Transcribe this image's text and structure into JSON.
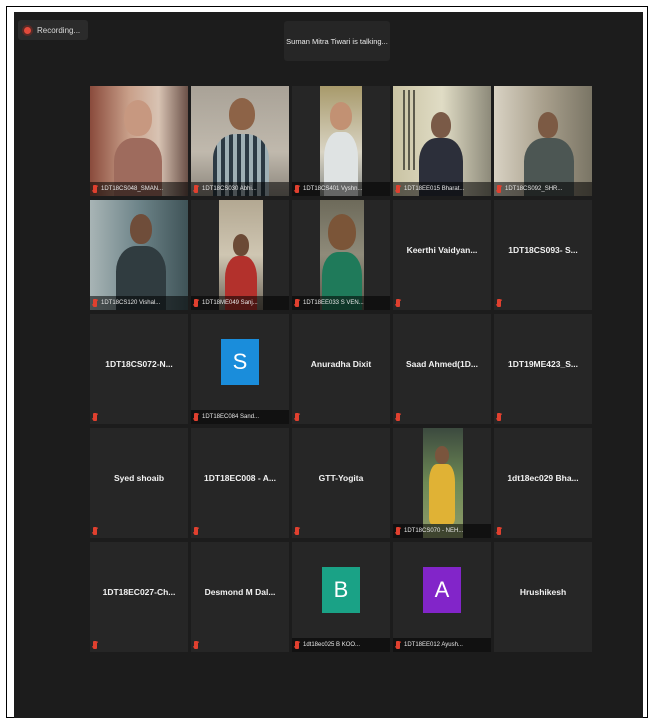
{
  "recording": {
    "label": "Recording..."
  },
  "speaking": {
    "text": "Suman Mitra Tiwari is talking..."
  },
  "colors": {
    "avatar_s": "#1a8ddb",
    "avatar_b": "#1aa286",
    "avatar_a": "#8225c9",
    "mic_muted": "#e0402f"
  },
  "participants": [
    {
      "name": "1DT18CS048_SMAN...",
      "display": "video"
    },
    {
      "name": "1DT18CS030 Abhi...",
      "display": "video"
    },
    {
      "name": "1DT18CS401 Vyshn...",
      "display": "video"
    },
    {
      "name": "1DT18EE015 Bharat...",
      "display": "video"
    },
    {
      "name": "1DT18CS092_SHR...",
      "display": "video"
    },
    {
      "name": "1DT18CS120 Vishal...",
      "display": "video"
    },
    {
      "name": "1DT18ME049 Sanj...",
      "display": "video"
    },
    {
      "name": "1DT18EE033 S VEN...",
      "display": "video"
    },
    {
      "name": "Keerthi Vaidyan...",
      "display": "name"
    },
    {
      "name": "1DT18CS093- S...",
      "display": "name"
    },
    {
      "name": "1DT18CS072-N...",
      "display": "name"
    },
    {
      "name": "1DT18EC084 Sand...",
      "display": "avatar",
      "letter": "S"
    },
    {
      "name": "Anuradha Dixit",
      "display": "name"
    },
    {
      "name": "Saad Ahmed(1D...",
      "display": "name"
    },
    {
      "name": "1DT19ME423_S...",
      "display": "name"
    },
    {
      "name": "Syed shoaib",
      "display": "name"
    },
    {
      "name": "1DT18EC008 - A...",
      "display": "name"
    },
    {
      "name": "GTT-Yogita",
      "display": "name"
    },
    {
      "name": "1DT18CS070 - NEH...",
      "display": "video"
    },
    {
      "name": "1dt18ec029 Bha...",
      "display": "name"
    },
    {
      "name": "1DT18EC027-Ch...",
      "display": "name"
    },
    {
      "name": "Desmond M Dal...",
      "display": "name"
    },
    {
      "name": "1dt18ec025 B KOO...",
      "display": "avatar",
      "letter": "B"
    },
    {
      "name": "1DT18EE012 Ayush...",
      "display": "avatar",
      "letter": "A"
    },
    {
      "name": "Hrushikesh",
      "display": "name"
    }
  ]
}
